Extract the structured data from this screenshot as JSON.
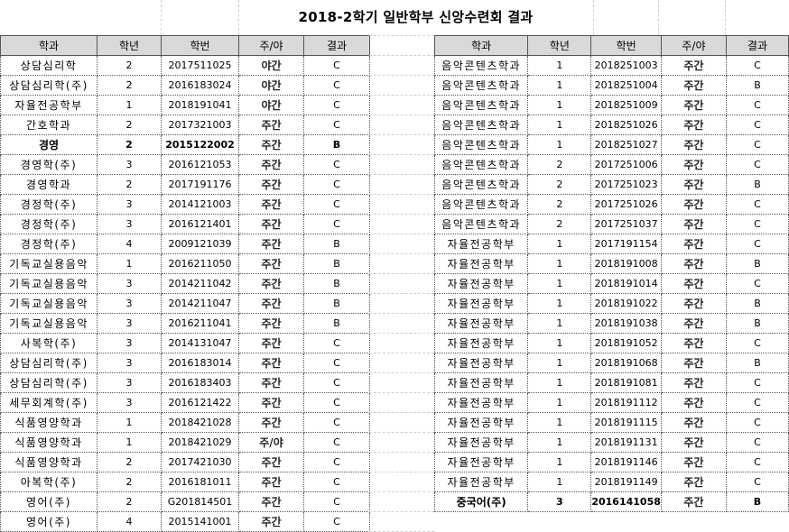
{
  "title": "2018-2학기 일반학부 신앙수련회 결과",
  "headers": [
    "학과",
    "학년",
    "학번",
    "주/야",
    "결과"
  ],
  "left_rows": [
    [
      "상담심리학",
      "2",
      "2017511025",
      "야간",
      "C"
    ],
    [
      "상담심리학(주)",
      "2",
      "2016183024",
      "야간",
      "C"
    ],
    [
      "자율전공학부",
      "1",
      "2018191041",
      "야간",
      "C"
    ],
    [
      "간호학과",
      "2",
      "2017321003",
      "주간",
      "C"
    ],
    [
      "경영",
      "2",
      "2015122002",
      "주간",
      "B"
    ],
    [
      "경영학(주)",
      "3",
      "2016121053",
      "주간",
      "C"
    ],
    [
      "경영학과",
      "2",
      "2017191176",
      "주간",
      "C"
    ],
    [
      "경정학(주)",
      "3",
      "2014121003",
      "주간",
      "C"
    ],
    [
      "경정학(주)",
      "3",
      "2016121401",
      "주간",
      "C"
    ],
    [
      "경정학(주)",
      "4",
      "2009121039",
      "주간",
      "B"
    ],
    [
      "기독교실용음악",
      "1",
      "2016211050",
      "주간",
      "B"
    ],
    [
      "기독교실용음악",
      "3",
      "2014211042",
      "주간",
      "B"
    ],
    [
      "기독교실용음악",
      "3",
      "2014211047",
      "주간",
      "B"
    ],
    [
      "기독교실용음악",
      "3",
      "2016211041",
      "주간",
      "B"
    ],
    [
      "사복학(주)",
      "3",
      "2014131047",
      "주간",
      "C"
    ],
    [
      "상담심리학(주)",
      "3",
      "2016183014",
      "주간",
      "C"
    ],
    [
      "상담심리학(주)",
      "3",
      "2016183403",
      "주간",
      "C"
    ],
    [
      "세무회계학(주)",
      "3",
      "2016121422",
      "주간",
      "C"
    ],
    [
      "식품영양학과",
      "1",
      "2018421028",
      "주간",
      "C"
    ],
    [
      "식품영양학과",
      "1",
      "2018421029",
      "주/야",
      "C"
    ],
    [
      "식품영양학과",
      "2",
      "2017421030",
      "주간",
      "C"
    ],
    [
      "아복학(주)",
      "2",
      "2016181011",
      "주간",
      "C"
    ],
    [
      "영어(주)",
      "2",
      "G201814501",
      "주간",
      "C"
    ],
    [
      "영어(주)",
      "4",
      "2015141001",
      "주간",
      "C"
    ]
  ],
  "right_rows": [
    [
      "음악콘텐츠학과",
      "1",
      "2018251003",
      "주간",
      "C"
    ],
    [
      "음악콘텐츠학과",
      "1",
      "2018251004",
      "주간",
      "B"
    ],
    [
      "음악콘텐츠학과",
      "1",
      "2018251009",
      "주간",
      "C"
    ],
    [
      "음악콘텐츠학과",
      "1",
      "2018251026",
      "주간",
      "C"
    ],
    [
      "음악콘텐츠학과",
      "1",
      "2018251027",
      "주간",
      "C"
    ],
    [
      "음악콘텐츠학과",
      "2",
      "2017251006",
      "주간",
      "C"
    ],
    [
      "음악콘텐츠학과",
      "2",
      "2017251023",
      "주간",
      "B"
    ],
    [
      "음악콘텐츠학과",
      "2",
      "2017251026",
      "주간",
      "C"
    ],
    [
      "음악콘텐츠학과",
      "2",
      "2017251037",
      "주간",
      "C"
    ],
    [
      "자율전공학부",
      "1",
      "2017191154",
      "주간",
      "C"
    ],
    [
      "자율전공학부",
      "1",
      "2018191008",
      "주간",
      "B"
    ],
    [
      "자율전공학부",
      "1",
      "2018191014",
      "주간",
      "C"
    ],
    [
      "자율전공학부",
      "1",
      "2018191022",
      "주간",
      "B"
    ],
    [
      "자율전공학부",
      "1",
      "2018191038",
      "주간",
      "B"
    ],
    [
      "자율전공학부",
      "1",
      "2018191052",
      "주간",
      "C"
    ],
    [
      "자율전공학부",
      "1",
      "2018191068",
      "주간",
      "B"
    ],
    [
      "자율전공학부",
      "1",
      "2018191081",
      "주간",
      "C"
    ],
    [
      "자율전공학부",
      "1",
      "2018191112",
      "주간",
      "C"
    ],
    [
      "자율전공학부",
      "1",
      "2018191115",
      "주간",
      "C"
    ],
    [
      "자율전공학부",
      "1",
      "2018191131",
      "주간",
      "C"
    ],
    [
      "자율전공학부",
      "1",
      "2018191146",
      "주간",
      "C"
    ],
    [
      "자율전공학부",
      "1",
      "2018191149",
      "주간",
      "C"
    ],
    [
      "중국어(주)",
      "3",
      "2016141058",
      "주간",
      "B"
    ]
  ],
  "bold_rows": {
    "left": [
      4
    ],
    "right": [
      22
    ]
  }
}
